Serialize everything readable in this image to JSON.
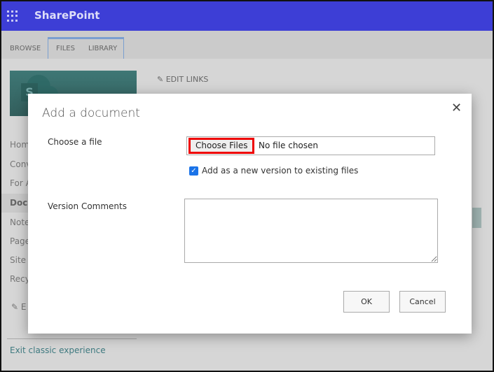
{
  "header": {
    "brand": "SharePoint",
    "icon": "waffle-icon"
  },
  "ribbon": {
    "tabs": [
      "BROWSE",
      "FILES",
      "LIBRARY"
    ]
  },
  "top_links": {
    "edit_links": "EDIT LINKS"
  },
  "sidebar": {
    "items": [
      "Hom",
      "Conv",
      "For A",
      "Docu",
      "Note",
      "Page",
      "Site",
      "Recy"
    ],
    "edit": "E",
    "exit": "Exit classic experience"
  },
  "dialog": {
    "title": "Add a document",
    "close": "✕",
    "choose_label": "Choose a file",
    "choose_button": "Choose Files",
    "no_file": "No file chosen",
    "checkbox_label": "Add as a new version to existing files",
    "checkbox_checked": true,
    "version_label": "Version Comments",
    "version_value": "",
    "ok": "OK",
    "cancel": "Cancel"
  },
  "colors": {
    "header": "#3d3ed6",
    "highlight": "#e00000",
    "teal": "#3e7775"
  }
}
